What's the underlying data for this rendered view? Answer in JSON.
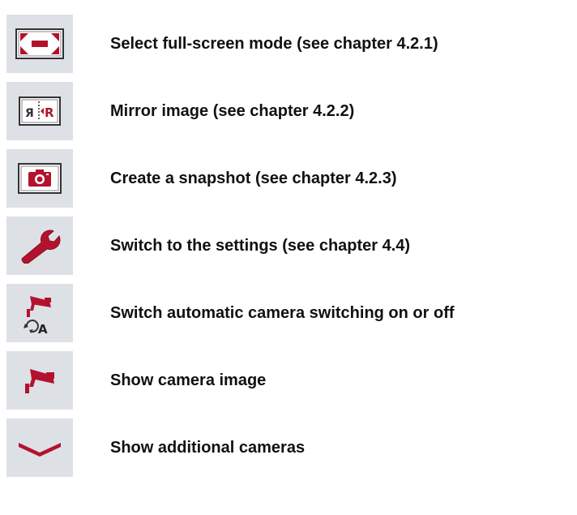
{
  "colors": {
    "tile_background": "#dde1e6",
    "accent": "#b3122e",
    "text": "#111111"
  },
  "items": [
    {
      "icon": "fullscreen-icon",
      "label": "Select full-screen mode (see chapter 4.2.1)"
    },
    {
      "icon": "mirror-image-icon",
      "label": "Mirror image (see chapter 4.2.2)"
    },
    {
      "icon": "snapshot-camera-icon",
      "label": "Create a snapshot (see chapter 4.2.3)"
    },
    {
      "icon": "wrench-icon",
      "label": "Switch to the settings (see chapter 4.4)"
    },
    {
      "icon": "auto-camera-switch-icon",
      "label": "Switch automatic camera switching on or off"
    },
    {
      "icon": "camera-image-icon",
      "label": "Show camera image"
    },
    {
      "icon": "chevron-down-icon",
      "label": "Show additional cameras"
    }
  ]
}
